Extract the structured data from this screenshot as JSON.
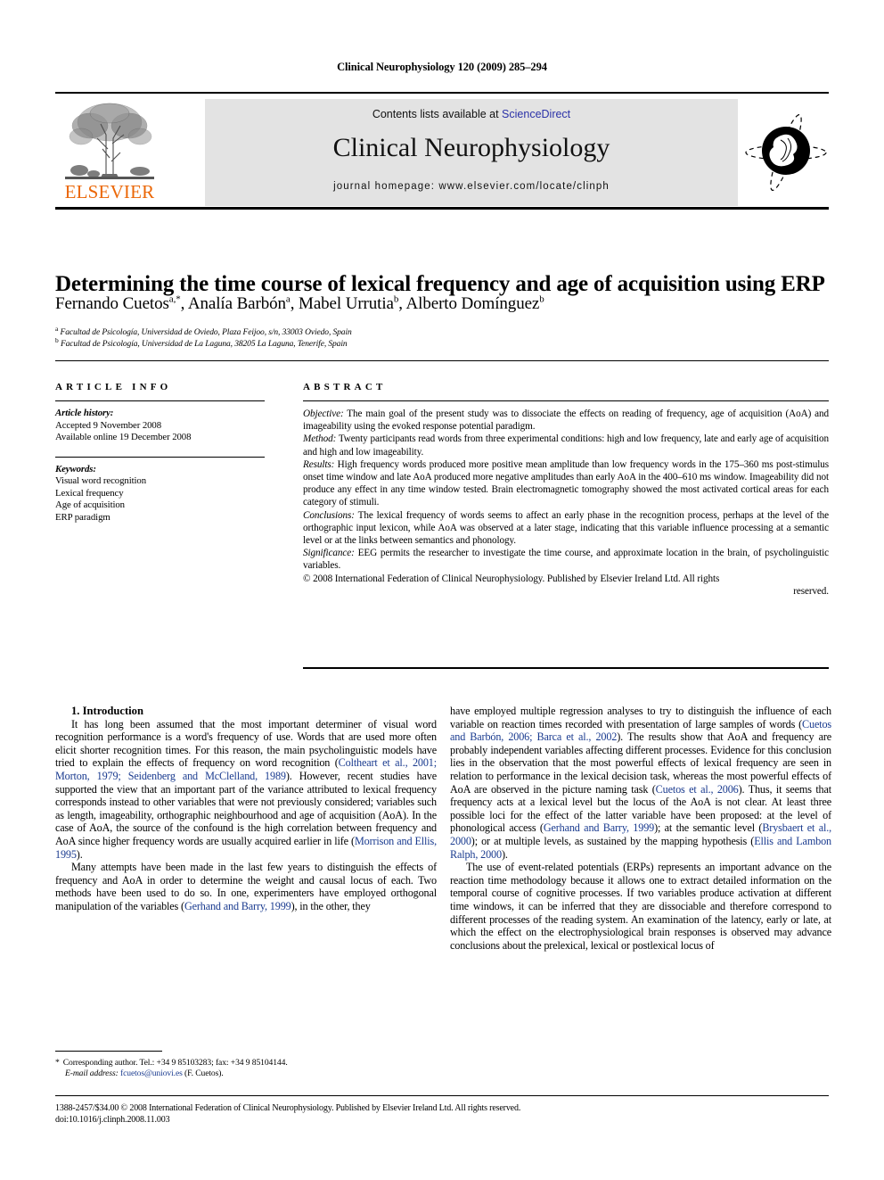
{
  "running_head": "Clinical Neurophysiology 120 (2009) 285–294",
  "masthead": {
    "contents_prefix": "Contents lists available at ",
    "sciencedirect": "ScienceDirect",
    "journal_name": "Clinical Neurophysiology",
    "homepage": "journal homepage: www.elsevier.com/locate/clinph",
    "publisher_wordmark": "ELSEVIER",
    "publisher_color": "#eb6707",
    "link_color": "#2b32a8",
    "band_color": "#e3e3e3"
  },
  "article": {
    "title": "Determining the time course of lexical frequency and age of acquisition using ERP",
    "authors": "Fernando Cuetos a,*, Analía Barbón a, Mabel Urrutia b, Alberto Domínguez b",
    "affiliation_a": "Facultad de Psicología, Universidad de Oviedo, Plaza Feijoo, s/n, 33003 Oviedo, Spain",
    "affiliation_b": "Facultad de Psicología, Universidad de La Laguna, 38205 La Laguna, Tenerife, Spain"
  },
  "info": {
    "heading": "ARTICLE INFO",
    "history_label": "Article history:",
    "history_lines": [
      "Accepted 9 November 2008",
      "Available online 19 December 2008"
    ],
    "keywords_label": "Keywords:",
    "keywords": [
      "Visual word recognition",
      "Lexical frequency",
      "Age of acquisition",
      "ERP paradigm"
    ]
  },
  "abstract": {
    "heading": "ABSTRACT",
    "objective_label": "Objective:",
    "objective_text": " The main goal of the present study was to dissociate the effects on reading of frequency, age of acquisition (AoA) and imageability using the evoked response potential paradigm.",
    "method_label": "Method:",
    "method_text": " Twenty participants read words from three experimental conditions: high and low frequency, late and early age of acquisition and high and low imageability.",
    "results_label": "Results:",
    "results_text": " High frequency words produced more positive mean amplitude than low frequency words in the 175–360 ms post-stimulus onset time window and late AoA produced more negative amplitudes than early AoA in the 400–610 ms window. Imageability did not produce any effect in any time window tested. Brain electromagnetic tomography showed the most activated cortical areas for each category of stimuli.",
    "conclusions_label": "Conclusions:",
    "conclusions_text": " The lexical frequency of words seems to affect an early phase in the recognition process, perhaps at the level of the orthographic input lexicon, while AoA was observed at a later stage, indicating that this variable influence processing at a semantic level or at the links between semantics and phonology.",
    "significance_label": "Significance:",
    "significance_text": " EEG permits the researcher to investigate the time course, and approximate location in the brain, of psycholinguistic variables.",
    "copyright_main": "© 2008 International Federation of Clinical Neurophysiology. Published by Elsevier Ireland Ltd. All rights",
    "copyright_tail": "reserved."
  },
  "introduction": {
    "heading": "1. Introduction",
    "left_p1_a": "It has long been assumed that the most important determiner of visual word recognition performance is a word's frequency of use. Words that are used more often elicit shorter recognition times. For this reason, the main psycholinguistic models have tried to explain the effects of frequency on word recognition (",
    "left_p1_ref1": "Coltheart et al., 2001; Morton, 1979; Seidenberg and McClelland, 1989",
    "left_p1_b": "). However, recent studies have supported the view that an important part of the variance attributed to lexical frequency corresponds instead to other variables that were not previously considered; variables such as length, imageability, orthographic neighbourhood and age of acquisition (AoA). In the case of AoA, the source of the confound is the high correlation between frequency and AoA since higher frequency words are usually acquired earlier in life (",
    "left_p1_ref2": "Morrison and Ellis, 1995",
    "left_p1_c": ").",
    "left_p2_a": "Many attempts have been made in the last few years to distinguish the effects of frequency and AoA in order to determine the weight and causal locus of each. Two methods have been used to do so. In one, experimenters have employed orthogonal manipulation of the variables (",
    "left_p2_ref1": "Gerhand and Barry, 1999",
    "left_p2_b": "), in the other, they",
    "right_p1_a": "have employed multiple regression analyses to try to distinguish the influence of each variable on reaction times recorded with presentation of large samples of words (",
    "right_p1_ref1": "Cuetos and Barbón, 2006; Barca et al., 2002",
    "right_p1_b": "). The results show that AoA and frequency are probably independent variables affecting different processes. Evidence for this conclusion lies in the observation that the most powerful effects of lexical frequency are seen in relation to performance in the lexical decision task, whereas the most powerful effects of AoA are observed in the picture naming task (",
    "right_p1_ref2": "Cuetos et al., 2006",
    "right_p1_c": "). Thus, it seems that frequency acts at a lexical level but the locus of the AoA is not clear. At least three possible loci for the effect of the latter variable have been proposed: at the level of phonological access (",
    "right_p1_ref3": "Gerhand and Barry, 1999",
    "right_p1_d": "); at the semantic level (",
    "right_p1_ref4": "Brysbaert et al., 2000",
    "right_p1_e": "); or at multiple levels, as sustained by the mapping hypothesis (",
    "right_p1_ref5": "Ellis and Lambon Ralph, 2000",
    "right_p1_f": ").",
    "right_p2": "The use of event-related potentials (ERPs) represents an important advance on the reaction time methodology because it allows one to extract detailed information on the temporal course of cognitive processes. If two variables produce activation at different time windows, it can be inferred that they are dissociable and therefore correspond to different processes of the reading system. An examination of the latency, early or late, at which the effect on the electrophysiological brain responses is observed may advance conclusions about the prelexical, lexical or postlexical locus of"
  },
  "footnote": {
    "marker": "*",
    "corresponding": "Corresponding author. Tel.: +34 9 85103283; fax: +34 9 85104144.",
    "email_label": "E-mail address:",
    "email": " fcuetos@uniovi.es",
    "email_suffix": " (F. Cuetos)."
  },
  "imprint": {
    "line1": "1388-2457/$34.00 © 2008 International Federation of Clinical Neurophysiology. Published by Elsevier Ireland Ltd. All rights reserved.",
    "line2": "doi:10.1016/j.clinph.2008.11.003"
  }
}
